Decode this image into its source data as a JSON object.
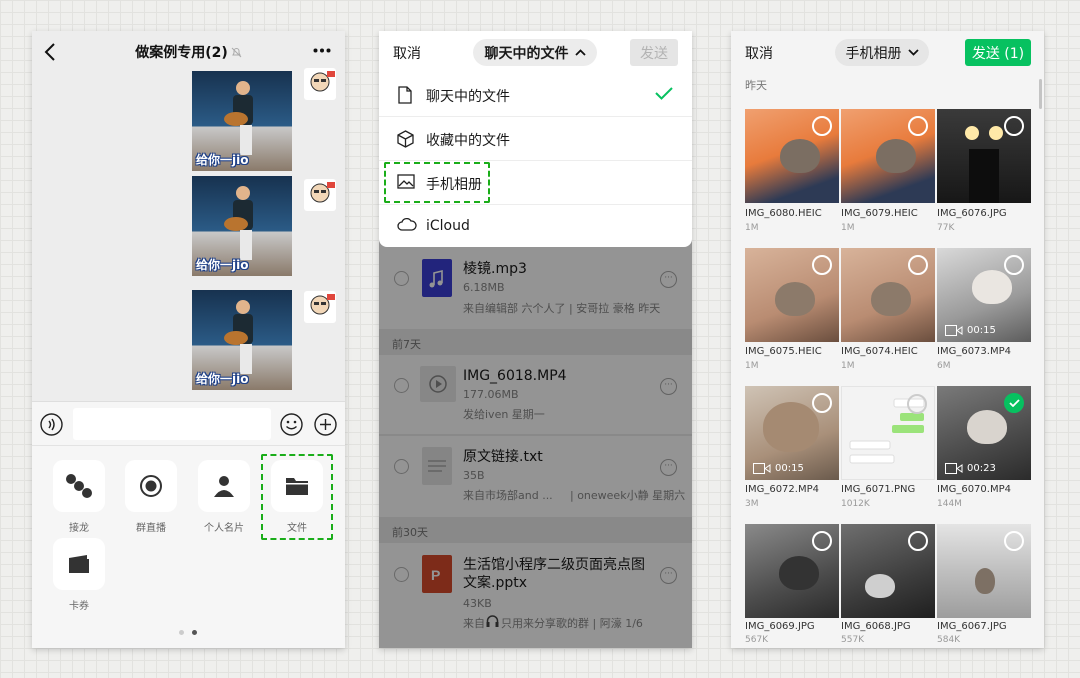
{
  "chat": {
    "title": "做案例专用(2)",
    "sticker_caption": "给你一jio",
    "tools": [
      "接龙",
      "群直播",
      "个人名片",
      "文件",
      "卡券"
    ]
  },
  "file_picker": {
    "cancel": "取消",
    "source": "聊天中的文件",
    "send": "发送",
    "menu": [
      "聊天中的文件",
      "收藏中的文件",
      "手机相册",
      "iCloud"
    ],
    "sections": [
      "前7天",
      "前30天"
    ],
    "files": [
      {
        "name": "棱镜.mp3",
        "size": "6.18MB",
        "source": "来自编辑部 六个人了 | 安哥拉 豪格 昨天"
      },
      {
        "name": "IMG_6018.MP4",
        "size": "177.06MB",
        "source": "发给iven 星期一"
      },
      {
        "name": "原文链接.txt",
        "size": "35B",
        "source": "来自市场部and ...",
        "source_b": "| oneweek小静 星期六"
      },
      {
        "name_1": "生活馆小程序二级页面亮点图",
        "name_2": "文案.pptx",
        "size": "43KB",
        "source_a": "来自",
        "source_b": "只用来分享歌的群 | 阿濠 1/6"
      }
    ]
  },
  "album": {
    "cancel": "取消",
    "source": "手机相册",
    "send": "发送 (1)",
    "date": "昨天",
    "photos": [
      {
        "name": "IMG_6080.HEIC",
        "size": "1M"
      },
      {
        "name": "IMG_6079.HEIC",
        "size": "1M"
      },
      {
        "name": "IMG_6076.JPG",
        "size": "77K"
      },
      {
        "name": "IMG_6075.HEIC",
        "size": "1M"
      },
      {
        "name": "IMG_6074.HEIC",
        "size": "1M"
      },
      {
        "name": "IMG_6073.MP4",
        "size": "6M",
        "duration": "00:15"
      },
      {
        "name": "IMG_6072.MP4",
        "size": "3M",
        "duration": "00:15"
      },
      {
        "name": "IMG_6071.PNG",
        "size": "1012K"
      },
      {
        "name": "IMG_6070.MP4",
        "size": "144M",
        "duration": "00:23",
        "selected": true
      },
      {
        "name": "IMG_6069.JPG",
        "size": "567K"
      },
      {
        "name": "IMG_6068.JPG",
        "size": "557K"
      },
      {
        "name": "IMG_6067.JPG",
        "size": "584K"
      }
    ]
  },
  "colors": {
    "accent": "#07c160",
    "highlight": "#1aad19"
  }
}
